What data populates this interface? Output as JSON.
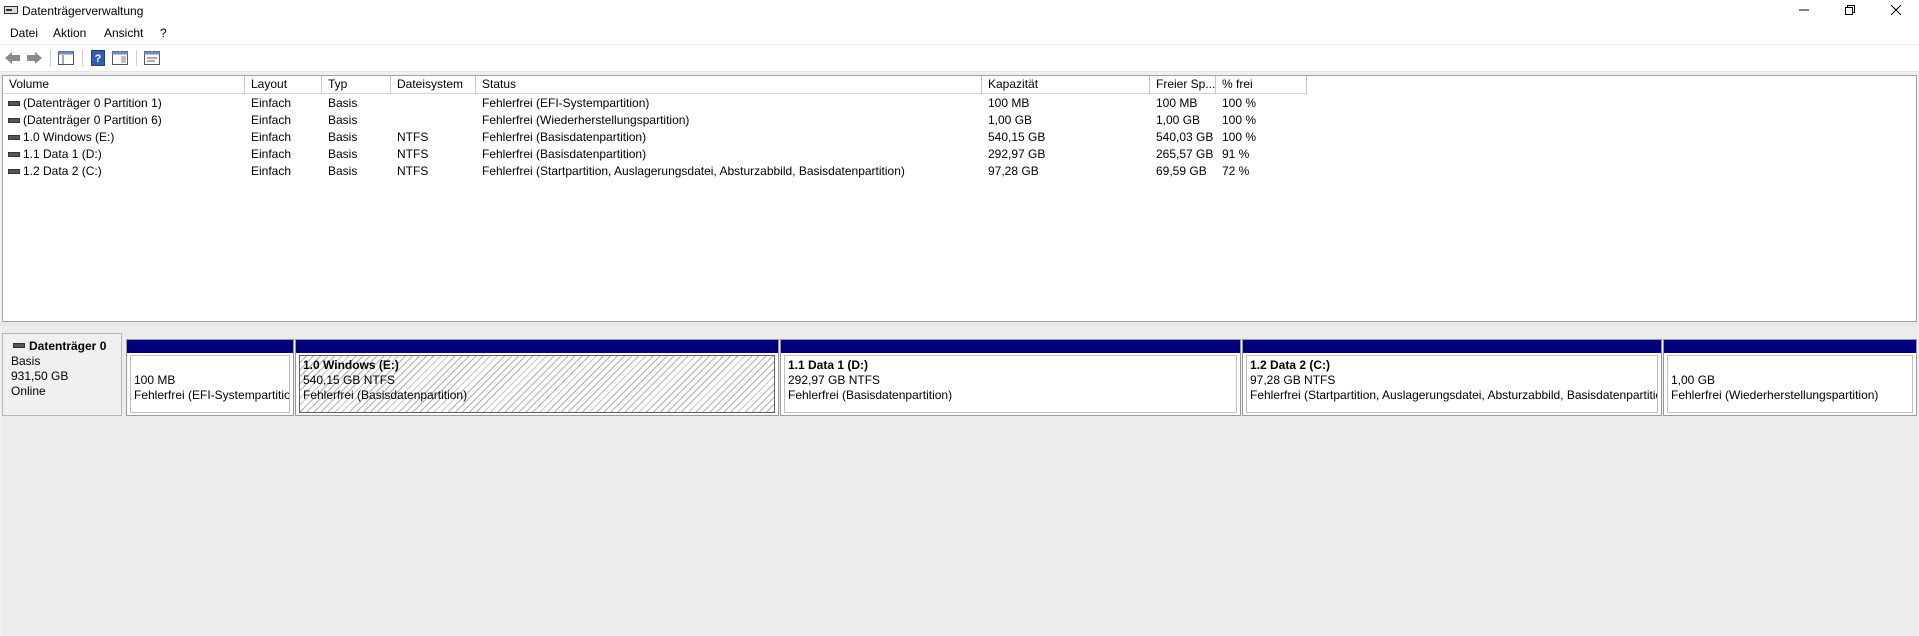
{
  "window": {
    "title": "Datenträgerverwaltung"
  },
  "menu": [
    "Datei",
    "Aktion",
    "Ansicht",
    "?"
  ],
  "volume_table": {
    "columns": [
      "Volume",
      "Layout",
      "Typ",
      "Dateisystem",
      "Status",
      "Kapazität",
      "Freier Sp...",
      "% frei"
    ],
    "rows": [
      [
        "(Datenträger 0 Partition 1)",
        "Einfach",
        "Basis",
        "",
        "Fehlerfrei (EFI-Systempartition)",
        "100 MB",
        "100 MB",
        "100 %"
      ],
      [
        "(Datenträger 0 Partition 6)",
        "Einfach",
        "Basis",
        "",
        "Fehlerfrei (Wiederherstellungspartition)",
        "1,00 GB",
        "1,00 GB",
        "100 %"
      ],
      [
        "1.0 Windows (E:)",
        "Einfach",
        "Basis",
        "NTFS",
        "Fehlerfrei (Basisdatenpartition)",
        "540,15 GB",
        "540,03 GB",
        "100 %"
      ],
      [
        "1.1 Data 1 (D:)",
        "Einfach",
        "Basis",
        "NTFS",
        "Fehlerfrei (Basisdatenpartition)",
        "292,97 GB",
        "265,57 GB",
        "91 %"
      ],
      [
        "1.2 Data 2 (C:)",
        "Einfach",
        "Basis",
        "NTFS",
        "Fehlerfrei (Startpartition, Auslagerungsdatei, Absturzabbild, Basisdatenpartition)",
        "97,28 GB",
        "69,59 GB",
        "72 %"
      ]
    ]
  },
  "disk": {
    "name": "Datenträger 0",
    "type": "Basis",
    "size": "931,50 GB",
    "state": "Online",
    "partitions": [
      {
        "label": "",
        "size": "100 MB",
        "status": "Fehlerfrei (EFI-Systempartitio"
      },
      {
        "label": "1.0 Windows  (E:)",
        "size": "540,15 GB NTFS",
        "status": "Fehlerfrei (Basisdatenpartition)"
      },
      {
        "label": "1.1 Data 1  (D:)",
        "size": "292,97 GB NTFS",
        "status": "Fehlerfrei (Basisdatenpartition)"
      },
      {
        "label": "1.2 Data 2  (C:)",
        "size": "97,28 GB NTFS",
        "status": "Fehlerfrei (Startpartition, Auslagerungsdatei, Absturzabbild, Basisdatenpartitic"
      },
      {
        "label": "",
        "size": "1,00 GB",
        "status": "Fehlerfrei (Wiederherstellungspartition)"
      }
    ]
  },
  "colors": {
    "partition_bar": "#00007f"
  }
}
